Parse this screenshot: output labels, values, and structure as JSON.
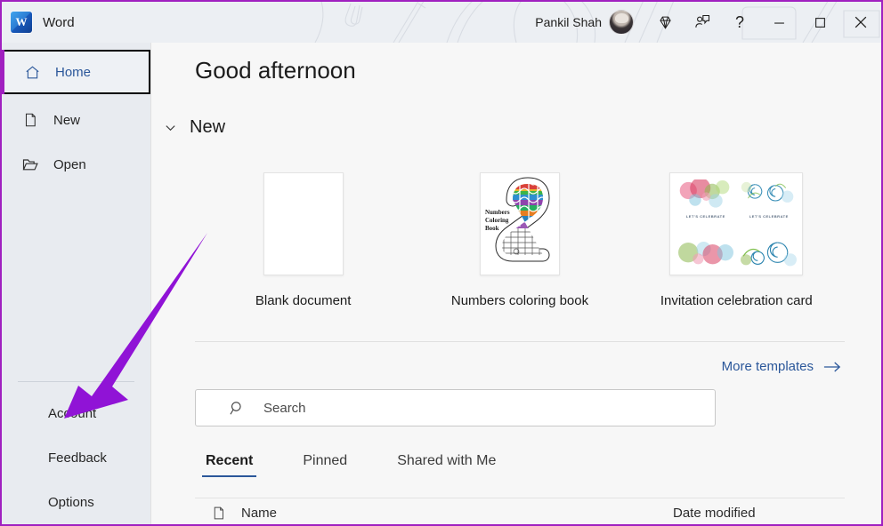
{
  "window": {
    "app_name": "Word",
    "app_icon": "word-logo-icon",
    "user_name": "Pankil Shah",
    "buttons": {
      "premium": "diamond-icon",
      "collaborate": "person-chat-icon",
      "help": "?",
      "minimize": "–",
      "maximize": "☐",
      "close": "✕"
    }
  },
  "sidebar": {
    "top_items": [
      {
        "label": "Home",
        "icon": "home-icon",
        "selected": true
      },
      {
        "label": "New",
        "icon": "new-document-icon",
        "selected": false
      },
      {
        "label": "Open",
        "icon": "open-folder-icon",
        "selected": false
      }
    ],
    "bottom_items": [
      {
        "label": "Account"
      },
      {
        "label": "Feedback"
      },
      {
        "label": "Options"
      }
    ]
  },
  "main": {
    "greeting": "Good afternoon",
    "section": {
      "title": "New",
      "collapse_icon": "chevron-down-icon"
    },
    "templates": [
      {
        "label": "Blank document",
        "kind": "blank"
      },
      {
        "label": "Numbers coloring book",
        "kind": "coloring",
        "thumb_text": "Numbers\nColoring\nBook"
      },
      {
        "label": "Invitation celebration card",
        "kind": "invitation",
        "caption": "LET'S CELEBRATE"
      }
    ],
    "more_templates": {
      "label": "More templates",
      "icon": "arrow-right-icon"
    },
    "search": {
      "placeholder": "Search",
      "value": "",
      "icon": "search-icon"
    },
    "tabs": [
      {
        "label": "Recent",
        "active": true
      },
      {
        "label": "Pinned",
        "active": false
      },
      {
        "label": "Shared with Me",
        "active": false
      }
    ],
    "table": {
      "icon": "document-icon",
      "columns": [
        "Name",
        "Date modified"
      ]
    }
  },
  "annotation": {
    "type": "arrow",
    "color": "#9013d6",
    "points_to": "Account"
  },
  "colors": {
    "accent_blue": "#2b579a",
    "sidebar_bg": "#e8ebf0",
    "main_bg": "#f7f7f7",
    "titlebar_bg": "#eceff3",
    "annotation_purple": "#9013d6",
    "frame_purple": "#a020c0"
  }
}
